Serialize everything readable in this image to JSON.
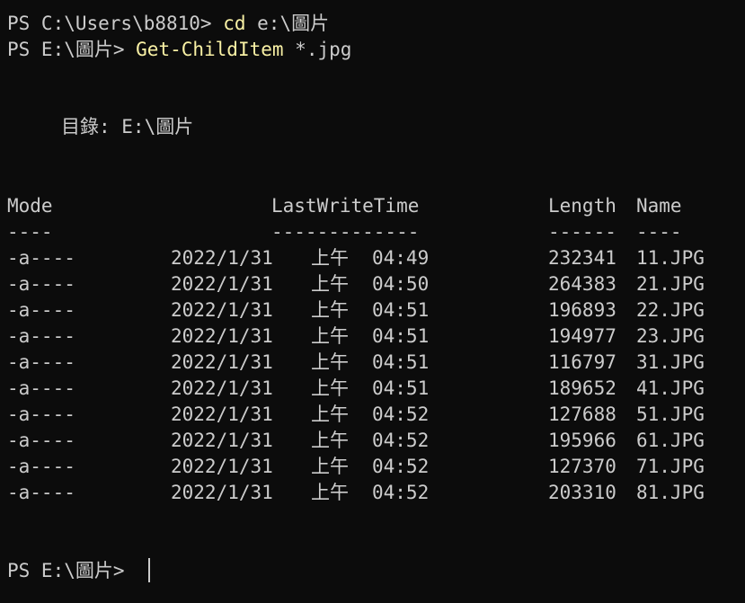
{
  "prompt1": {
    "path": "PS C:\\Users\\b8810> ",
    "command": "cd",
    "args": " e:\\圖片"
  },
  "prompt2": {
    "path": "PS E:\\圖片> ",
    "command": "Get-ChildItem",
    "args": " *.jpg"
  },
  "directory_label": "目錄: E:\\圖片",
  "headers": {
    "mode": "Mode",
    "lastwritetime": "LastWriteTime",
    "length": "Length",
    "name": "Name"
  },
  "separators": {
    "mode": "----",
    "lastwritetime": "-------------",
    "length": "------",
    "name": "----"
  },
  "rows": [
    {
      "mode": "-a----",
      "date": "2022/1/31",
      "ampm": "上午",
      "time": "04:49",
      "length": "232341",
      "name": "11.JPG"
    },
    {
      "mode": "-a----",
      "date": "2022/1/31",
      "ampm": "上午",
      "time": "04:50",
      "length": "264383",
      "name": "21.JPG"
    },
    {
      "mode": "-a----",
      "date": "2022/1/31",
      "ampm": "上午",
      "time": "04:51",
      "length": "196893",
      "name": "22.JPG"
    },
    {
      "mode": "-a----",
      "date": "2022/1/31",
      "ampm": "上午",
      "time": "04:51",
      "length": "194977",
      "name": "23.JPG"
    },
    {
      "mode": "-a----",
      "date": "2022/1/31",
      "ampm": "上午",
      "time": "04:51",
      "length": "116797",
      "name": "31.JPG"
    },
    {
      "mode": "-a----",
      "date": "2022/1/31",
      "ampm": "上午",
      "time": "04:51",
      "length": "189652",
      "name": "41.JPG"
    },
    {
      "mode": "-a----",
      "date": "2022/1/31",
      "ampm": "上午",
      "time": "04:52",
      "length": "127688",
      "name": "51.JPG"
    },
    {
      "mode": "-a----",
      "date": "2022/1/31",
      "ampm": "上午",
      "time": "04:52",
      "length": "195966",
      "name": "61.JPG"
    },
    {
      "mode": "-a----",
      "date": "2022/1/31",
      "ampm": "上午",
      "time": "04:52",
      "length": "127370",
      "name": "71.JPG"
    },
    {
      "mode": "-a----",
      "date": "2022/1/31",
      "ampm": "上午",
      "time": "04:52",
      "length": "203310",
      "name": "81.JPG"
    }
  ],
  "prompt3": {
    "path": "PS E:\\圖片> "
  },
  "colors": {
    "background": "#0c0c0c",
    "foreground": "#cccccc",
    "command": "#f9f1a5"
  }
}
